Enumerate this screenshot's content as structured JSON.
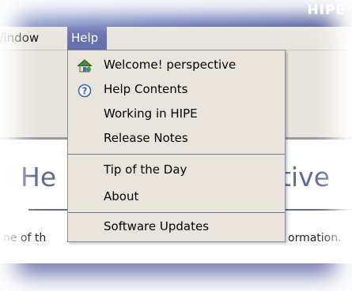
{
  "titlebar": {
    "title": "HIPE"
  },
  "menubar": {
    "window_label": "Window",
    "help_label": "Help"
  },
  "content": {
    "title_left": "He",
    "title_right": "tive",
    "text_left": "ne of th",
    "text_right": "ormation."
  },
  "help_menu": {
    "items": [
      {
        "label": "Welcome! perspective",
        "icon": "welcome-house-icon"
      },
      {
        "label": "Help Contents",
        "icon": "help-question-icon"
      },
      {
        "label": "Working in HIPE"
      },
      {
        "label": "Release Notes"
      },
      {
        "label": "Tip of the Day"
      },
      {
        "label": "About"
      },
      {
        "label": "Software Updates"
      }
    ]
  },
  "colors": {
    "menu_highlight": "#6871b0",
    "menu_background": "#e9e5dc",
    "title_accent": "#5d6a9a"
  }
}
